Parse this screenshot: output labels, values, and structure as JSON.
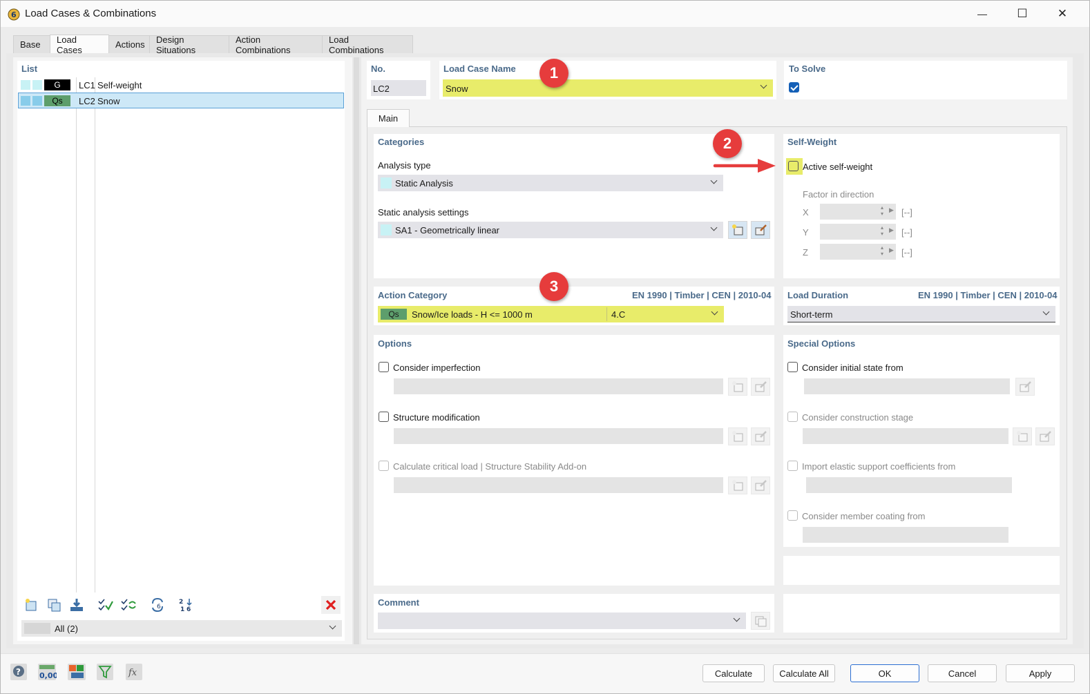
{
  "window": {
    "title": "Load Cases & Combinations",
    "minimize": "—",
    "maximize": "☐",
    "close": "✕"
  },
  "tabs": [
    "Base",
    "Load Cases",
    "Actions",
    "Design Situations",
    "Action Combinations",
    "Load Combinations"
  ],
  "active_tab": "Load Cases",
  "list": {
    "header": "List",
    "items": [
      {
        "category": "G",
        "id": "LC1",
        "name": "Self-weight",
        "cat_bg": "#000000",
        "cat_fg": "#ffffff",
        "selected": false
      },
      {
        "category": "Qs",
        "id": "LC2",
        "name": "Snow",
        "cat_bg": "#5d9e6c",
        "cat_fg": "#000000",
        "selected": true
      }
    ],
    "filter": "All (2)"
  },
  "header": {
    "no_label": "No.",
    "no_value": "LC2",
    "name_label": "Load Case Name",
    "name_value": "Snow",
    "to_solve_label": "To Solve",
    "to_solve_checked": true
  },
  "subtab": "Main",
  "categories": {
    "title": "Categories",
    "analysis_type_label": "Analysis type",
    "analysis_type_value": "Static Analysis",
    "static_settings_label": "Static analysis settings",
    "static_settings_value": "SA1 - Geometrically linear"
  },
  "self_weight": {
    "title": "Self-Weight",
    "active_label": "Active self-weight",
    "active_checked": false,
    "factor_label": "Factor in direction",
    "directions": [
      {
        "axis": "X",
        "unit": "[--]"
      },
      {
        "axis": "Y",
        "unit": "[--]"
      },
      {
        "axis": "Z",
        "unit": "[--]"
      }
    ]
  },
  "action_category": {
    "title": "Action Category",
    "standard": "EN 1990 | Timber | CEN | 2010-04",
    "code": "Qs",
    "value": "Snow/Ice loads - H <= 1000 m",
    "clause": "4.C"
  },
  "load_duration": {
    "title": "Load Duration",
    "standard": "EN 1990 | Timber | CEN | 2010-04",
    "value": "Short-term"
  },
  "options": {
    "title": "Options",
    "items": [
      {
        "label": "Consider imperfection",
        "enabled": true
      },
      {
        "label": "Structure modification",
        "enabled": true
      },
      {
        "label": "Calculate critical load | Structure Stability Add-on",
        "enabled": false
      }
    ]
  },
  "special_options": {
    "title": "Special Options",
    "items": [
      {
        "label": "Consider initial state from",
        "enabled": true
      },
      {
        "label": "Consider construction stage",
        "enabled": false
      },
      {
        "label": "Import elastic support coefficients from",
        "enabled": false
      },
      {
        "label": "Consider member coating from",
        "enabled": false
      }
    ]
  },
  "comment": {
    "title": "Comment",
    "value": ""
  },
  "annotations": [
    "1",
    "2",
    "3"
  ],
  "footer": {
    "calculate": "Calculate",
    "calculate_all": "Calculate All",
    "ok": "OK",
    "cancel": "Cancel",
    "apply": "Apply",
    "units_icon_text": "0,00"
  },
  "colors": {
    "highlight": "#e8ec6a",
    "accent_blue": "#1560b7",
    "section_title": "#4a6a8a",
    "annotation_red": "#e63c3c",
    "selection": "#cde8f7"
  }
}
